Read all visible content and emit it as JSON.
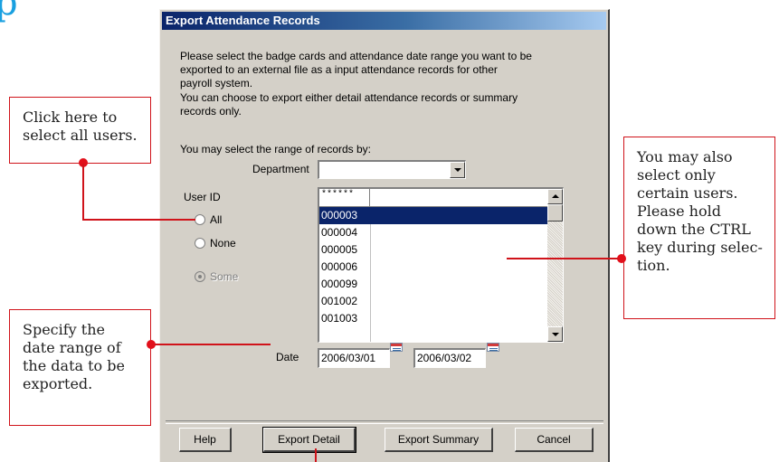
{
  "corner_glyph": "p",
  "dialog": {
    "title": "Export Attendance Records",
    "description": [
      "Please select the badge cards and attendance date range you want to be",
      "exported to an external file as a input attendance records for other",
      "payroll system.",
      "You can choose to export either detail attendance records or summary",
      "records only."
    ],
    "range_prompt": "You may select the range of records by:",
    "department": {
      "label": "Department",
      "value": ""
    },
    "user_id": {
      "label": "User ID",
      "options": [
        {
          "label": "All",
          "checked": false,
          "disabled": false
        },
        {
          "label": "None",
          "checked": false,
          "disabled": false
        },
        {
          "label": "Some",
          "checked": true,
          "disabled": true
        }
      ]
    },
    "user_list": {
      "header": "******",
      "rows": [
        "000003",
        "000004",
        "000005",
        "000006",
        "000099",
        "001002",
        "001003"
      ],
      "selected_index": 0
    },
    "date": {
      "label": "Date",
      "from": "2006/03/01",
      "to": "2006/03/02"
    },
    "buttons": {
      "help": "Help",
      "export_detail": "Export Detail",
      "export_summary": "Export Summary",
      "cancel": "Cancel"
    }
  },
  "callouts": {
    "select_all": "Click here to\nselect all users.",
    "select_some": "You may also\nselect only\ncertain users.\nPlease hold\ndown the CTRL\nkey during selec-\ntion.",
    "date_range": "Specify the\ndate range of\nthe data to be\nexported."
  },
  "colors": {
    "title_bar": "#0a246a",
    "dialog_face": "#d4d0c8",
    "callout_red": "#d0131a",
    "selection": "#0a246a"
  }
}
